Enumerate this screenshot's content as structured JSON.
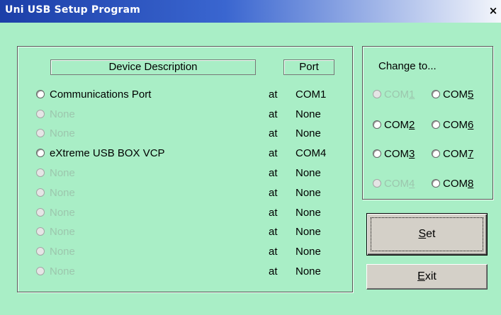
{
  "window": {
    "title": "Uni USB Setup Program",
    "close_label": "×"
  },
  "device_panel": {
    "header_description": "Device Description",
    "header_port": "Port",
    "rows": [
      {
        "description": "Communications Port",
        "at": "at",
        "port": "COM1",
        "enabled": true
      },
      {
        "description": "None",
        "at": "at",
        "port": "None",
        "enabled": false
      },
      {
        "description": "None",
        "at": "at",
        "port": "None",
        "enabled": false
      },
      {
        "description": "eXtreme USB BOX VCP",
        "at": "at",
        "port": "COM4",
        "enabled": true
      },
      {
        "description": "None",
        "at": "at",
        "port": "None",
        "enabled": false
      },
      {
        "description": "None",
        "at": "at",
        "port": "None",
        "enabled": false
      },
      {
        "description": "None",
        "at": "at",
        "port": "None",
        "enabled": false
      },
      {
        "description": "None",
        "at": "at",
        "port": "None",
        "enabled": false
      },
      {
        "description": "None",
        "at": "at",
        "port": "None",
        "enabled": false
      },
      {
        "description": "None",
        "at": "at",
        "port": "None",
        "enabled": false
      }
    ]
  },
  "change_panel": {
    "title": "Change to...",
    "options": [
      {
        "prefix": "COM",
        "digit": "1",
        "enabled": false
      },
      {
        "prefix": "COM",
        "digit": "5",
        "enabled": true
      },
      {
        "prefix": "COM",
        "digit": "2",
        "enabled": true
      },
      {
        "prefix": "COM",
        "digit": "6",
        "enabled": true
      },
      {
        "prefix": "COM",
        "digit": "3",
        "enabled": true
      },
      {
        "prefix": "COM",
        "digit": "7",
        "enabled": true
      },
      {
        "prefix": "COM",
        "digit": "4",
        "enabled": false
      },
      {
        "prefix": "COM",
        "digit": "8",
        "enabled": true
      }
    ]
  },
  "buttons": {
    "set": {
      "mnemonic": "S",
      "rest": "et"
    },
    "exit": {
      "mnemonic": "E",
      "rest": "xit"
    }
  },
  "colors": {
    "dialog_background": "#a9eec6",
    "titlebar_start": "#1c3fa8",
    "titlebar_end": "#f4f6fb",
    "disabled_text": "#9cc6ad",
    "button_face": "#d4d0c8"
  }
}
